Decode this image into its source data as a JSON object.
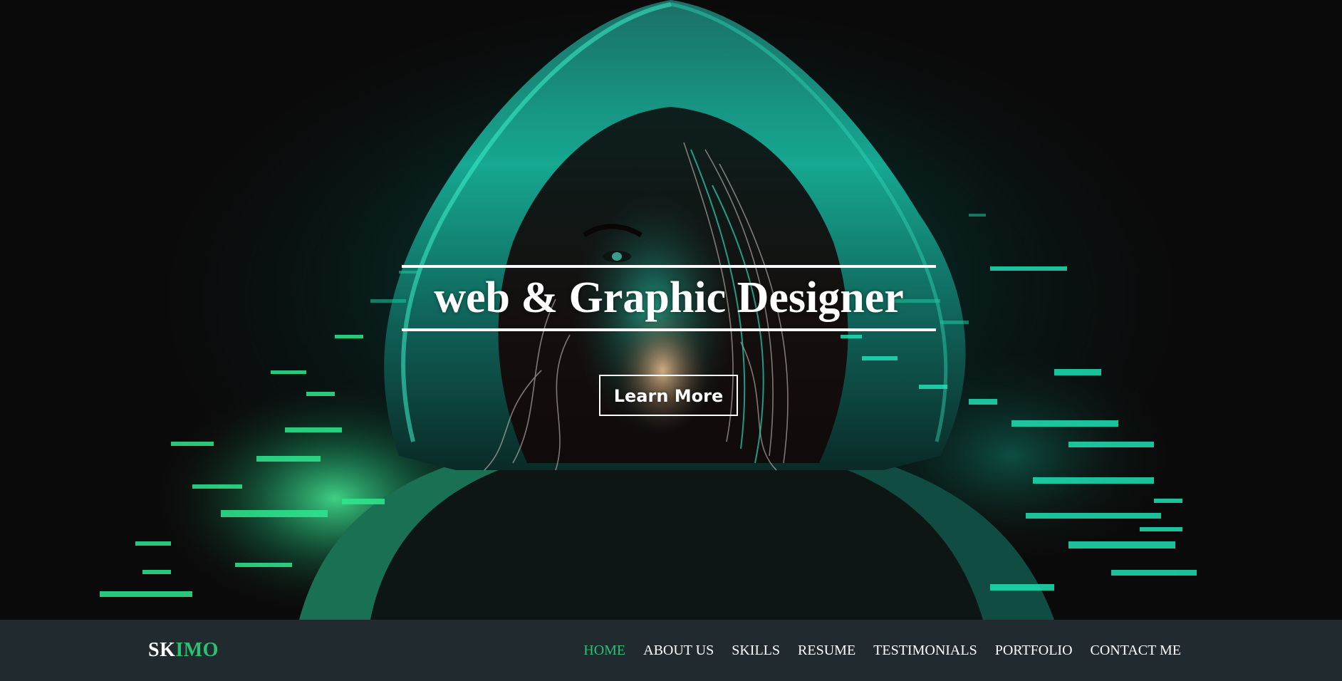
{
  "hero": {
    "headline": "web & Graphic Designer",
    "cta_label": "Learn More",
    "accent_color": "#1fe0b4"
  },
  "navbar": {
    "brand_part_a": "SK",
    "brand_part_b": "IMO",
    "brand_accent_color": "#2fbf71",
    "active_color": "#2fbf71",
    "links": [
      {
        "label": "HOME",
        "active": true
      },
      {
        "label": "ABOUT US",
        "active": false
      },
      {
        "label": "SKILLS",
        "active": false
      },
      {
        "label": "RESUME",
        "active": false
      },
      {
        "label": "TESTIMONIALS",
        "active": false
      },
      {
        "label": "PORTFOLIO",
        "active": false
      },
      {
        "label": "CONTACT ME",
        "active": false
      }
    ]
  }
}
